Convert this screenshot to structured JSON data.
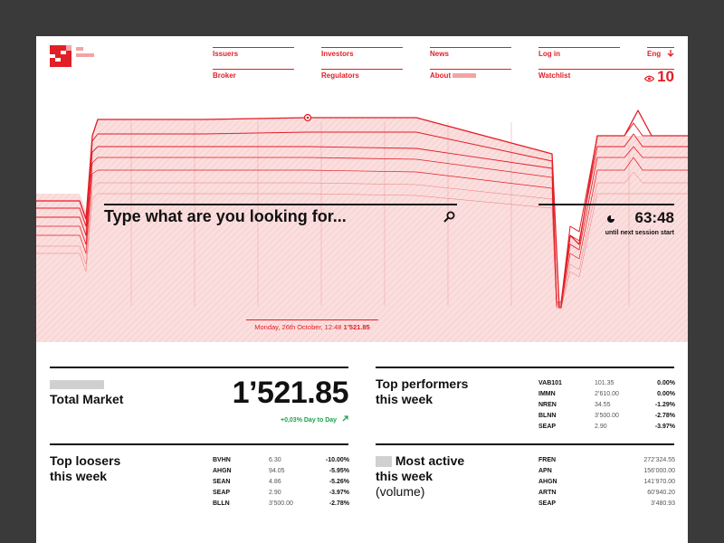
{
  "nav": {
    "issuers": "Issuers",
    "investors": "Investors",
    "news": "News",
    "login": "Log in",
    "language": "Eng",
    "broker": "Broker",
    "regulators": "Regulators",
    "about": "About",
    "watchlist": "Watchlist",
    "watch_count": "10"
  },
  "hero": {
    "search_placeholder": "Type what are you looking for...",
    "timer_value": "63:48",
    "timer_label": "until next session start",
    "chart_date": "Monday, 26th October, 12:48",
    "chart_value": "1’521.85"
  },
  "index": {
    "title": "Total Market",
    "value": "1’521.85",
    "change": "+0,03% Day to Day"
  },
  "top_performers": {
    "title_line1": "Top performers",
    "title_line2": "this week",
    "rows": [
      {
        "symbol": "VAB101",
        "price": "101.35",
        "change": "0.00%"
      },
      {
        "symbol": "IMMN",
        "price": "2’610.00",
        "change": "0.00%"
      },
      {
        "symbol": "NREN",
        "price": "34.55",
        "change": "-1.29%"
      },
      {
        "symbol": "BLNN",
        "price": "3’500.00",
        "change": "-2.78%"
      },
      {
        "symbol": "SEAP",
        "price": "2.90",
        "change": "-3.97%"
      }
    ]
  },
  "top_losers": {
    "title_line1": "Top loosers",
    "title_line2": "this week",
    "rows": [
      {
        "symbol": "BVHN",
        "price": "6.30",
        "change": "-10.00%"
      },
      {
        "symbol": "AHGN",
        "price": "94.05",
        "change": "-5.95%"
      },
      {
        "symbol": "SEAN",
        "price": "4.86",
        "change": "-5.26%"
      },
      {
        "symbol": "SEAP",
        "price": "2.90",
        "change": "-3.97%"
      },
      {
        "symbol": "BLLN",
        "price": "3’500.00",
        "change": "-2.78%"
      }
    ]
  },
  "most_active": {
    "title_line1": "Most active",
    "title_line2": "this week",
    "title_line3": "(volume)",
    "rows": [
      {
        "symbol": "FREN",
        "volume": "272’324.55"
      },
      {
        "symbol": "APN",
        "volume": "156’000.00"
      },
      {
        "symbol": "AHGN",
        "volume": "141’970.00"
      },
      {
        "symbol": "ARTN",
        "volume": "60’940.20"
      },
      {
        "symbol": "SEAP",
        "volume": "3’480.93"
      }
    ]
  },
  "colors": {
    "accent": "#e21e26",
    "chart_fill": "#fbdede",
    "positive": "#1aa34a",
    "frame": "#3a3a3a"
  }
}
